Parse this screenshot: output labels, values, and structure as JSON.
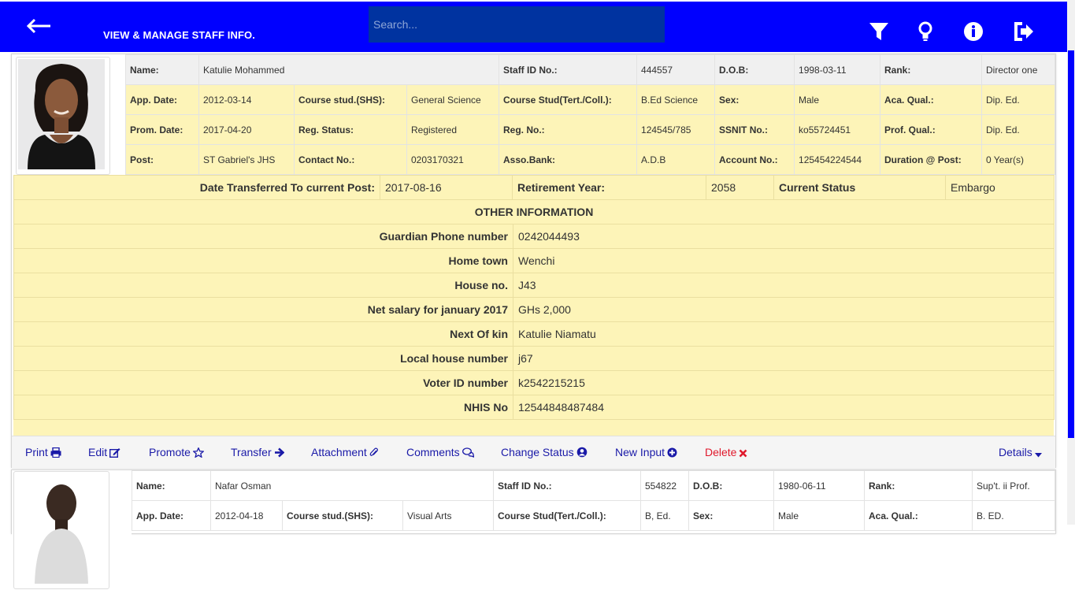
{
  "header": {
    "title": "VIEW & MANAGE STAFF INFO.",
    "search_placeholder": "Search..."
  },
  "staff": [
    {
      "rows": [
        [
          "Name:",
          "Katulie Mohammed",
          "Staff ID No.:",
          "444557",
          "D.O.B:",
          "1998-03-11",
          "Rank:",
          "Director one"
        ],
        [
          "App. Date:",
          "2012-03-14",
          "Course stud.(SHS):",
          "General Science",
          "Course Stud(Tert./Coll.):",
          "B.Ed Science",
          "Sex:",
          "Male",
          "Aca. Qual.:",
          "Dip. Ed."
        ],
        [
          "Prom. Date:",
          "2017-04-20",
          "Reg. Status:",
          "Registered",
          "Reg. No.:",
          "124545/785",
          "SSNIT No.:",
          "ko55724451",
          "Prof. Qual.:",
          "Dip. Ed."
        ],
        [
          "Post:",
          "ST Gabriel's JHS",
          "Contact No.:",
          "0203170321",
          "Asso.Bank:",
          "A.D.B",
          "Account No.:",
          "125454224544",
          "Duration @ Post:",
          "0 Year(s)"
        ]
      ],
      "transfer": {
        "date_label": "Date Transferred To current Post:",
        "date_value": "2017-08-16",
        "retire_label": "Retirement Year:",
        "retire_value": "2058",
        "status_label": "Current Status",
        "status_value": "Embargo"
      },
      "other_heading": "OTHER INFORMATION",
      "other": [
        {
          "label": "Guardian Phone number",
          "value": "0242044493"
        },
        {
          "label": "Home town",
          "value": "Wenchi"
        },
        {
          "label": "House no.",
          "value": "J43"
        },
        {
          "label": "Net salary for january 2017",
          "value": "GHs 2,000"
        },
        {
          "label": "Next Of kin",
          "value": "Katulie Niamatu"
        },
        {
          "label": "Local house number",
          "value": "j67"
        },
        {
          "label": "Voter ID number",
          "value": "k2542215215"
        },
        {
          "label": "NHIS No",
          "value": "12544848487484"
        }
      ],
      "actions": {
        "print": "Print",
        "edit": "Edit",
        "promote": "Promote",
        "transfer": "Transfer",
        "attachment": "Attachment",
        "comments": "Comments",
        "change_status": "Change Status",
        "new_input": "New Input",
        "delete": "Delete",
        "details": "Details"
      }
    },
    {
      "rows": [
        [
          "Name:",
          "Nafar Osman",
          "Staff ID No.:",
          "554822",
          "D.O.B:",
          "1980-06-11",
          "Rank:",
          "Sup't. ii Prof."
        ],
        [
          "App. Date:",
          "2012-04-18",
          "Course stud.(SHS):",
          "Visual Arts",
          "Course Stud(Tert./Coll.):",
          "B, Ed.",
          "Sex:",
          "Male",
          "Aca. Qual.:",
          "B. ED."
        ]
      ]
    }
  ],
  "colors": {
    "header_bg": "#0000ff",
    "search_bg": "#0033a0",
    "row_highlight": "#fdf4b8",
    "action_link": "#1a1aa8",
    "delete_link": "#e0192c"
  }
}
